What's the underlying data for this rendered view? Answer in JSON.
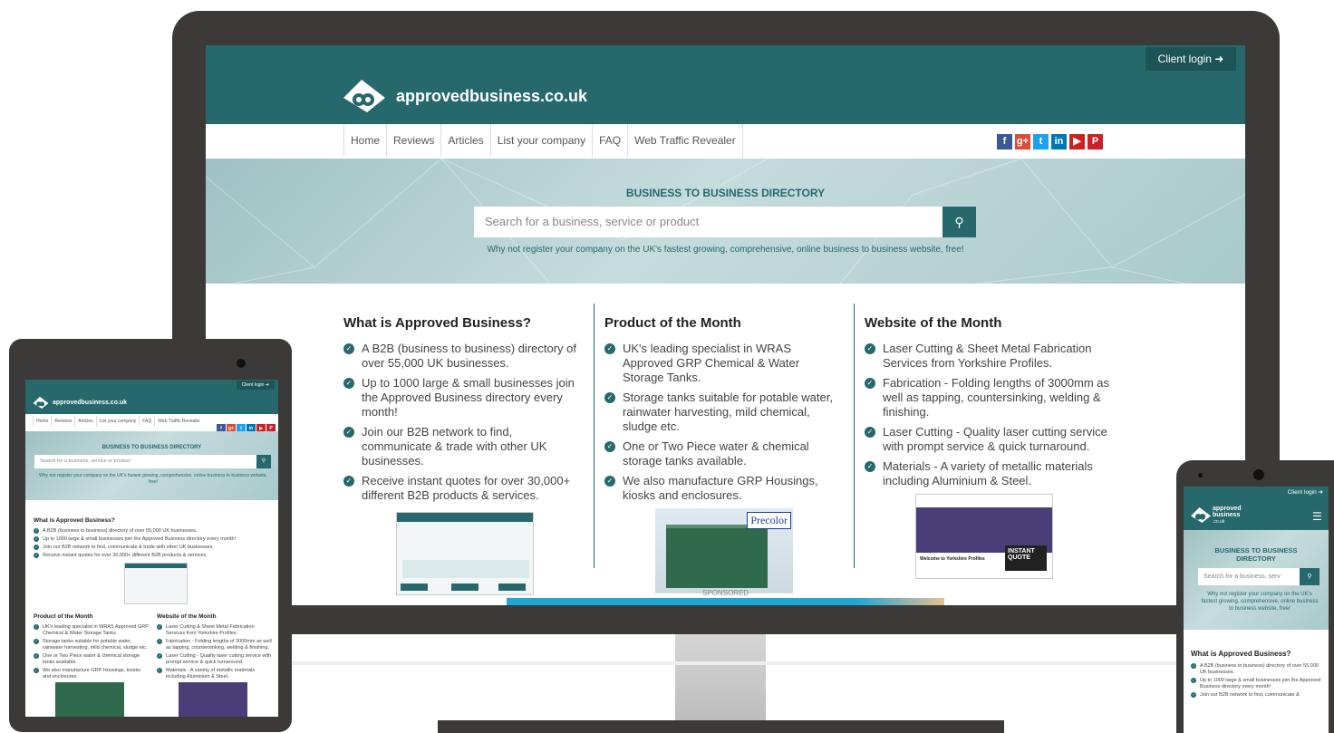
{
  "site": {
    "logo_text": "approvedbusiness.co.uk",
    "client_login": "Client login ➜",
    "mobile_logo": "approved business",
    "mobile_logo_sub": ".co.uk"
  },
  "nav": [
    "Home",
    "Reviews",
    "Articles",
    "List your company",
    "FAQ",
    "Web Traffic Revealer"
  ],
  "social": [
    {
      "icon": "facebook-icon",
      "glyph": "f",
      "color": "#3b5998"
    },
    {
      "icon": "google-plus-icon",
      "glyph": "g+",
      "color": "#dd4b39"
    },
    {
      "icon": "twitter-icon",
      "glyph": "t",
      "color": "#1da1f2"
    },
    {
      "icon": "linkedin-icon",
      "glyph": "in",
      "color": "#0077b5"
    },
    {
      "icon": "youtube-icon",
      "glyph": "▶",
      "color": "#cd201f"
    },
    {
      "icon": "pinterest-icon",
      "glyph": "P",
      "color": "#cb2027"
    }
  ],
  "hero": {
    "title": "BUSINESS TO BUSINESS DIRECTORY",
    "search_placeholder": "Search for a business, service or product",
    "mobile_search_placeholder": "Search for a business, serv",
    "tagline": "Why not register your company on the UK's fastest growing, comprehensive, online business to business website, free!"
  },
  "col1": {
    "title": "What is Approved Business?",
    "items": [
      "A B2B (business to business) directory of over 55,000 UK businesses.",
      "Up to 1000 large & small businesses join the Approved Business directory every month!",
      "Join our B2B network to find, communicate & trade with other UK businesses.",
      "Receive instant quotes for over 30,000+ different B2B products & services."
    ]
  },
  "col2": {
    "title": "Product of the Month",
    "items": [
      "UK's leading specialist in WRAS Approved GRP Chemical & Water Storage Tanks.",
      "Storage tanks suitable for potable water, rainwater harvesting, mild chemical, sludge etc.",
      "One or Two Piece water & chemical storage tanks available.",
      "We also manufacture GRP Housings, kiosks and enclosures."
    ],
    "brand": "Precolor"
  },
  "col3": {
    "title": "Website of the Month",
    "items": [
      "Laser Cutting & Sheet Metal Fabrication Services from Yorkshire Profiles.",
      "Fabrication - Folding lengths of 3000mm as well as tapping, countersinking, welding & finishing.",
      "Laser Cutting - Quality laser cutting service with prompt service & quick turnaround.",
      "Materials - A variety of metallic materials including Aluminium & Steel."
    ],
    "shot_title": "Welcome to Yorkshire Profiles",
    "shot_badge": "INSTANT QUOTE"
  },
  "sponsored": "SPONSORED",
  "mobile_items": [
    "A B2B (business to business) directory of over 55,000 UK businesses.",
    "Up to 1000 large & small businesses join the Approved Business directory every month!",
    "Join our B2B network to find, communicate &"
  ],
  "tablet_col1_items": [
    "A B2B (business to business) directory of over 55,000 UK businesses.",
    "Up to 1000 large & small businesses join the Approved Business directory every month!",
    "Join our B2B network to find, communicate & trade with other UK businesses.",
    "Receive instant quotes for over 30,000+ different B2B products & services."
  ],
  "colors": {
    "brand": "#26686b",
    "bezel": "#3b3a38"
  }
}
